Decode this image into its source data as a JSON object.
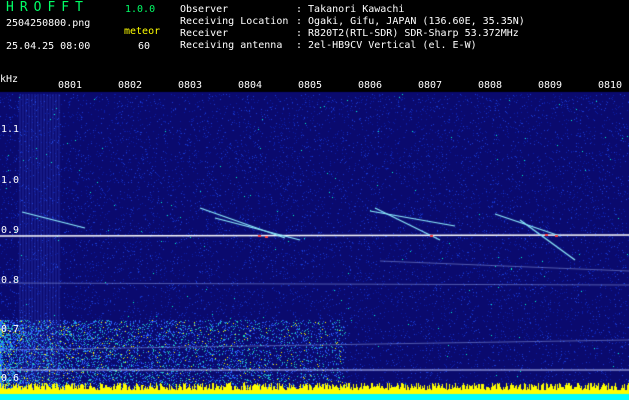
{
  "header": {
    "logo": "HROFFT",
    "version": "1.0.0",
    "filename": "2504250800.png",
    "datetime": "25.04.25 08:00",
    "mode_label": "meteor",
    "mode_value": "60",
    "meta": [
      {
        "label": "Observer",
        "value": ": Takanori Kawachi"
      },
      {
        "label": "Receiving Location",
        "value": ": Ogaki, Gifu, JAPAN (136.60E, 35.35N)"
      },
      {
        "label": "Receiver",
        "value": ": R820T2(RTL-SDR) SDR-Sharp 53.372MHz"
      },
      {
        "label": "Receiving antenna",
        "value": ": 2el-HB9CV Vertical (el. E-W)"
      }
    ]
  },
  "chart_data": {
    "type": "heatmap",
    "ylabel": "kHz",
    "yticks": [
      "1.1",
      "1.0",
      "0.9",
      "0.8",
      "0.7",
      "0.6"
    ],
    "xticks": [
      "0801",
      "0802",
      "0803",
      "0804",
      "0805",
      "0806",
      "0807",
      "0808",
      "0809",
      "0810"
    ]
  },
  "colors": {
    "background": "#0a0a6e",
    "noise": "#1a3fd8",
    "carrier": "#ffffff",
    "low_noise": "#ffff00"
  }
}
